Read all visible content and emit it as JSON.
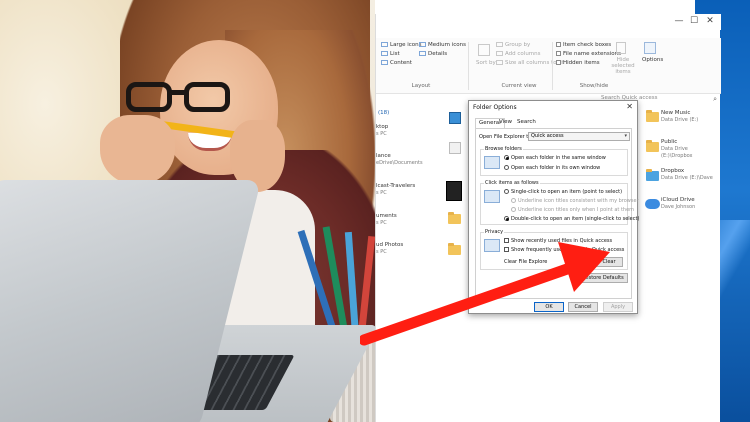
{
  "explorer": {
    "window_controls": {
      "minimize": "—",
      "maximize": "☐",
      "close": "✕"
    },
    "ribbon": {
      "layout": {
        "items": [
          "Large icons",
          "Medium icons",
          "List",
          "Details",
          "Content"
        ],
        "group_label": "Layout"
      },
      "current_view": {
        "sort_by": "Sort by",
        "items": [
          "Group by",
          "Add columns",
          "Size all columns to fit"
        ],
        "group_label": "Current view"
      },
      "show_hide": {
        "items": [
          "Item check boxes",
          "File name extensions",
          "Hidden items"
        ],
        "hide_selected": "Hide selected items",
        "options": "Options",
        "group_label": "Show/hide"
      }
    },
    "search_placeholder": "Search Quick access",
    "section_count": "(18)",
    "left_items": [
      {
        "name": "ktop",
        "sub": "s PC"
      },
      {
        "name": "lance",
        "sub": "eDrive\\Documents"
      },
      {
        "name": "lcast-Travelers",
        "sub": "s PC"
      },
      {
        "name": "uments",
        "sub": "s PC"
      },
      {
        "name": "s",
        "sub": "s PC"
      },
      {
        "name": "ud Photos",
        "sub": "s PC"
      }
    ],
    "right_items": [
      {
        "name": "New Music",
        "sub": "Data Drive (E:)"
      },
      {
        "name": "Public",
        "sub": "Data Drive (E:)\\Dropbox"
      },
      {
        "name": "Dropbox",
        "sub": "Data Drive (E:)\\Dave"
      },
      {
        "name": "iCloud Drive",
        "sub": "Dave Johnson"
      }
    ],
    "pin_glyph": "📌"
  },
  "dialog": {
    "title": "Folder Options",
    "close": "✕",
    "tabs": [
      "General",
      "View",
      "Search"
    ],
    "open_label": "Open File Explorer to:",
    "open_value": "Quick access",
    "browse": {
      "label": "Browse folders",
      "options": [
        "Open each folder in the same window",
        "Open each folder in its own window"
      ]
    },
    "click": {
      "label": "Click items as follows",
      "options": [
        "Single-click to open an item (point to select)",
        "Underline icon titles consistent with my browser",
        "Underline icon titles only when I point at them",
        "Double-click to open an item (single-click to select)"
      ]
    },
    "privacy": {
      "label": "Privacy",
      "options": [
        "Show recently used files in Quick access",
        "Show frequently used folders in Quick access"
      ],
      "clear_label": "Clear File Explore",
      "clear_button": "Clear"
    },
    "restore_button": "Restore Defaults",
    "ok": "OK",
    "cancel": "Cancel",
    "apply": "Apply"
  },
  "colors": {
    "arrow": "#ff1e12",
    "desktop": "#0a5fb8",
    "accent": "#0a64c8"
  }
}
